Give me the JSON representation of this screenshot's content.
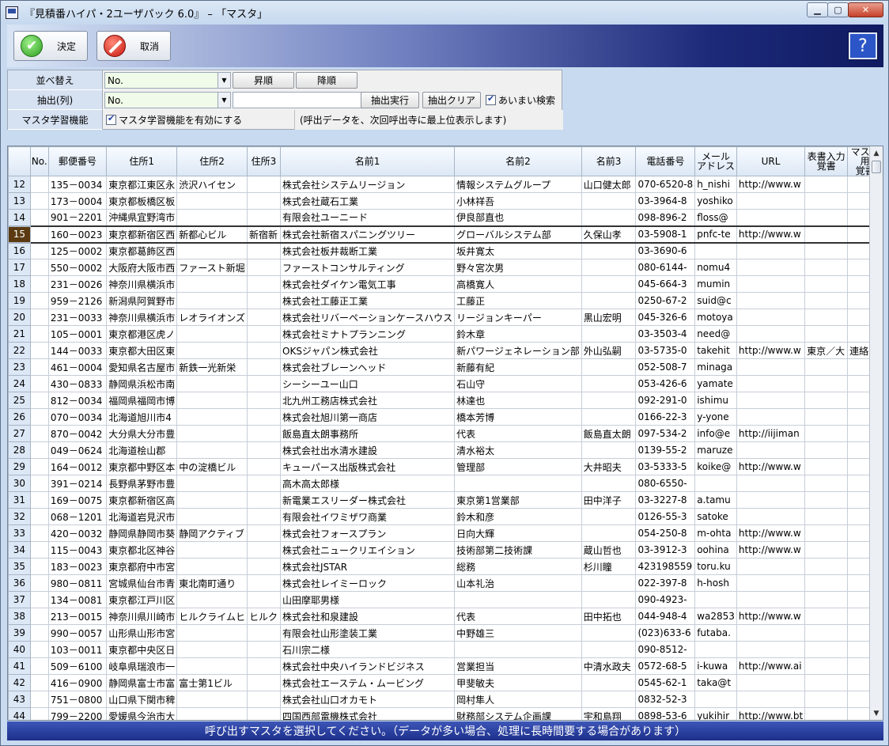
{
  "window": {
    "title": "『見積番ハイパ・2ユーザパック 6.0』 – 「マスタ」",
    "min_glyph": "▁",
    "max_glyph": "▢",
    "close_glyph": "✕"
  },
  "toolbar": {
    "ok_label": "決定",
    "cancel_label": "取消",
    "help_glyph": "?"
  },
  "filters": {
    "sort_label": "並べ替え",
    "sort_value": "No.",
    "asc_label": "昇順",
    "desc_label": "降順",
    "extract_label": "抽出(列)",
    "extract_value": "No.",
    "extract_text": "",
    "run_label": "抽出実行",
    "clear_label": "抽出クリア",
    "fuzzy_label": "あいまい検索",
    "learn_label": "マスタ学習機能",
    "learn_enable_label": "マスタ学習機能を有効にする",
    "learn_note": "(呼出データを、次回呼出寺に最上位表示します)"
  },
  "grid": {
    "headers": [
      "",
      "No.",
      "郵便番号",
      "住所1",
      "住所2",
      "住所3",
      "名前1",
      "名前2",
      "名前3",
      "電話番号",
      "メール\nアドレス",
      "URL",
      "表書入力\n覚書",
      "マスタ用\n覚書"
    ],
    "selected_row": 15,
    "rows": [
      [
        "12",
        "",
        "135－0034",
        "東京都江東区永",
        "渋沢ハイセン",
        "",
        "株式会社システムリージョン",
        "情報システムグループ",
        "山口健太郎",
        "070-6520-8",
        "h_nishi",
        "http://www.w",
        "",
        ""
      ],
      [
        "13",
        "",
        "173－0004",
        "東京都板橋区板",
        "",
        "",
        "株式会社蔵石工業",
        "小林祥吾",
        "",
        "03-3964-8",
        "yoshiko",
        "",
        "",
        ""
      ],
      [
        "14",
        "",
        "901－2201",
        "沖縄県宜野湾市",
        "",
        "",
        "有限会社ユーニード",
        "伊良部直也",
        "",
        "098-896-2",
        "floss@",
        "",
        "",
        ""
      ],
      [
        "15",
        "",
        "160－0023",
        "東京都新宿区西",
        "新都心ビル",
        "新宿新",
        "株式会社新宿スパニングツリー",
        "グローバルシステム部",
        "久保山孝",
        "03-5908-1",
        "pnfc-te",
        "http://www.w",
        "",
        ""
      ],
      [
        "16",
        "",
        "125－0002",
        "東京都葛飾区西",
        "",
        "",
        "株式会社板井裁断工業",
        "坂井寛太",
        "",
        "03-3690-6",
        "",
        "",
        "",
        ""
      ],
      [
        "17",
        "",
        "550－0002",
        "大阪府大阪市西",
        "ファースト新堀",
        "",
        "ファーストコンサルティング",
        "野々宮次男",
        "",
        "080-6144-",
        "nomu4",
        "",
        "",
        ""
      ],
      [
        "18",
        "",
        "231－0026",
        "神奈川県横浜市",
        "",
        "",
        "株式会社ダイケン電気工事",
        "高橋寛人",
        "",
        "045-664-3",
        "mumin",
        "",
        "",
        ""
      ],
      [
        "19",
        "",
        "959－2126",
        "新潟県阿賀野市",
        "",
        "",
        "株式会社工藤正工業",
        "工藤正",
        "",
        "0250-67-2",
        "suid@c",
        "",
        "",
        ""
      ],
      [
        "20",
        "",
        "231－0033",
        "神奈川県横浜市",
        "レオライオンズ",
        "",
        "株式会社リバーペーションケースハウス",
        "リージョンキーパー",
        "黒山宏明",
        "045-326-6",
        "motoya",
        "",
        "",
        ""
      ],
      [
        "21",
        "",
        "105－0001",
        "東京都港区虎ノ",
        "",
        "",
        "株式会社ミナトプランニング",
        "鈴木章",
        "",
        "03-3503-4",
        "need@",
        "",
        "",
        ""
      ],
      [
        "22",
        "",
        "144－0033",
        "東京都大田区東",
        "",
        "",
        "OKSジャパン株式会社",
        "新パワージェネレーション部",
        "外山弘嗣",
        "03-5735-0",
        "takehit",
        "http://www.w",
        "東京／大",
        "連絡先"
      ],
      [
        "23",
        "",
        "461－0004",
        "愛知県名古屋市",
        "新鉄一光新栄",
        "",
        "株式会社ブレーンヘッド",
        "新藤有紀",
        "",
        "052-508-7",
        "minaga",
        "",
        "",
        ""
      ],
      [
        "24",
        "",
        "430－0833",
        "静岡県浜松市南",
        "",
        "",
        "シーシーユー山口",
        "石山守",
        "",
        "053-426-6",
        "yamate",
        "",
        "",
        ""
      ],
      [
        "25",
        "",
        "812－0034",
        "福岡県福岡市博",
        "",
        "",
        "北九州工務店株式会社",
        "林達也",
        "",
        "092-291-0",
        "ishimu",
        "",
        "",
        ""
      ],
      [
        "26",
        "",
        "070－0034",
        "北海道旭川市4",
        "",
        "",
        "株式会社旭川第一商店",
        "橋本芳博",
        "",
        "0166-22-3",
        "y-yone",
        "",
        "",
        ""
      ],
      [
        "27",
        "",
        "870－0042",
        "大分県大分市豊",
        "",
        "",
        "飯島直太朗事務所",
        "代表",
        "飯島直太朗",
        "097-534-2",
        "info@e",
        "http://iijiman",
        "",
        ""
      ],
      [
        "28",
        "",
        "049－0624",
        "北海道桧山郡",
        "",
        "",
        "株式会社出水清水建設",
        "清水裕太",
        "",
        "0139-55-2",
        "maruze",
        "",
        "",
        ""
      ],
      [
        "29",
        "",
        "164－0012",
        "東京都中野区本",
        "中の淀橋ビル",
        "",
        "キューパース出版株式会社",
        "管理部",
        "大井昭夫",
        "03-5333-5",
        "koike@",
        "http://www.w",
        "",
        ""
      ],
      [
        "30",
        "",
        "391－0214",
        "長野県茅野市豊",
        "",
        "",
        "高木高太郎様",
        "",
        "",
        "080-6550-",
        "",
        "",
        "",
        ""
      ],
      [
        "31",
        "",
        "169－0075",
        "東京都新宿区高",
        "",
        "",
        "新電業エスリーダー株式会社",
        "東京第1営業部",
        "田中洋子",
        "03-3227-8",
        "a.tamu",
        "",
        "",
        ""
      ],
      [
        "32",
        "",
        "068－1201",
        "北海道岩見沢市",
        "",
        "",
        "有限会社イワミザワ商業",
        "鈴木和彦",
        "",
        "0126-55-3",
        "satoke",
        "",
        "",
        ""
      ],
      [
        "33",
        "",
        "420－0032",
        "静岡県静岡市葵",
        "静岡アクティブ",
        "",
        "株式会社フォースプラン",
        "日向大輝",
        "",
        "054-250-8",
        "m-ohta",
        "http://www.w",
        "",
        ""
      ],
      [
        "34",
        "",
        "115－0043",
        "東京都北区神谷",
        "",
        "",
        "株式会社ニュークリエイション",
        "技術部第二技術課",
        "蔵山哲也",
        "03-3912-3",
        "oohina",
        "http://www.w",
        "",
        ""
      ],
      [
        "35",
        "",
        "183－0023",
        "東京都府中市宮",
        "",
        "",
        "株式会社JSTAR",
        "総務",
        "杉川瞳",
        "423198559",
        "toru.ku",
        "",
        "",
        ""
      ],
      [
        "36",
        "",
        "980－0811",
        "宮城県仙台市青",
        "東北南町通り",
        "",
        "株式会社レイミーロック",
        "山本礼治",
        "",
        "022-397-8",
        "h-hosh",
        "",
        "",
        ""
      ],
      [
        "37",
        "",
        "134－0081",
        "東京都江戸川区",
        "",
        "",
        "山田摩耶男様",
        "",
        "",
        "090-4923-",
        "",
        "",
        "",
        ""
      ],
      [
        "38",
        "",
        "213－0015",
        "神奈川県川崎市",
        "ヒルクライムヒ",
        "ヒルク",
        "株式会社和泉建設",
        "代表",
        "田中拓也",
        "044-948-4",
        "wa2853",
        "http://www.w",
        "",
        ""
      ],
      [
        "39",
        "",
        "990－0057",
        "山形県山形市宮",
        "",
        "",
        "有限会社山形塗装工業",
        "中野雄三",
        "",
        "(023)633-6",
        "futaba.",
        "",
        "",
        ""
      ],
      [
        "40",
        "",
        "103－0011",
        "東京都中央区日",
        "",
        "",
        "石川宗二様",
        "",
        "",
        "090-8512-",
        "",
        "",
        "",
        ""
      ],
      [
        "41",
        "",
        "509－6100",
        "岐阜県瑞浪市一",
        "",
        "",
        "株式会社中央ハイランドビジネス",
        "営業担当",
        "中清水政夫",
        "0572-68-5",
        "i-kuwa",
        "http://www.ai",
        "",
        ""
      ],
      [
        "42",
        "",
        "416－0900",
        "静岡県富士市富",
        "富士第1ビル",
        "",
        "株式会社エーステム・ムービング",
        "甲斐敏夫",
        "",
        "0545-62-1",
        "taka@t",
        "",
        "",
        ""
      ],
      [
        "43",
        "",
        "751－0800",
        "山口県下関市稗",
        "",
        "",
        "株式会社山口オカモト",
        "岡村隼人",
        "",
        "0832-52-3",
        "",
        "",
        "",
        ""
      ],
      [
        "44",
        "",
        "799－2200",
        "愛媛県今治市大",
        "",
        "",
        "四国西部電機株式会社",
        "財務部システム企画課",
        "宇和島翔",
        "0898-53-6",
        "yukihir",
        "http://www.bt",
        "",
        ""
      ]
    ]
  },
  "status": {
    "message": "呼び出すマスタを選択してください。（データが多い場合、処理に長時間要する場合があります）"
  }
}
